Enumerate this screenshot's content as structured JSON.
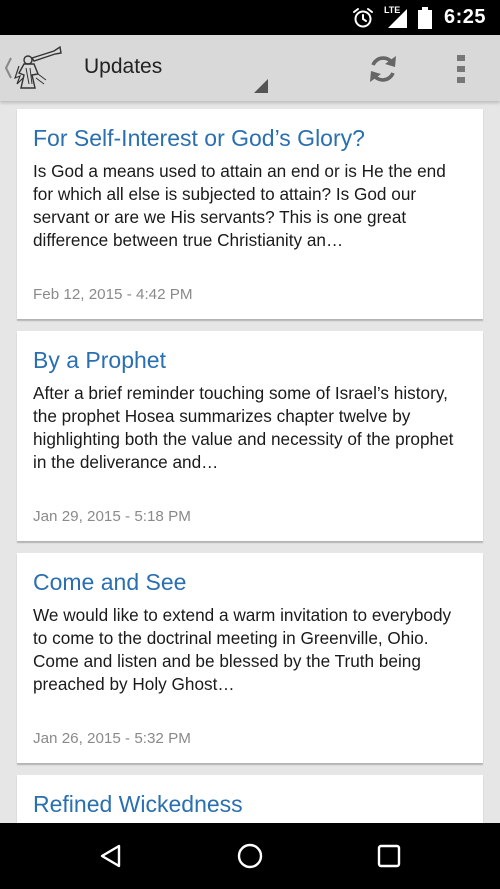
{
  "status_bar": {
    "time": "6:25",
    "network_label": "LTE",
    "icons": [
      "alarm-icon",
      "lte-signal-icon",
      "battery-icon"
    ]
  },
  "action_bar": {
    "title": "Updates",
    "icons": [
      "up-chevron-icon",
      "app-logo-icon",
      "refresh-icon",
      "overflow-menu-icon"
    ]
  },
  "posts": [
    {
      "title": "For Self-Interest or God’s Glory?",
      "excerpt": "Is God a means used to attain an end or is He the end for which all else is subjected to attain? Is God our servant or are we His servants? This is one great difference between true Christianity an…",
      "date": "Feb 12, 2015 - 4:42 PM"
    },
    {
      "title": "By a Prophet",
      "excerpt": "After a brief reminder touching some of Israel’s history, the prophet Hosea summarizes chapter twelve by highlighting both the value and necessity of the prophet in the deliverance and…",
      "date": "Jan 29, 2015 - 5:18 PM"
    },
    {
      "title": "Come and See",
      "excerpt": "We would like to extend a warm invitation to everybody to come to the doctrinal meeting in Greenville, Ohio. Come and listen and be blessed by the Truth being preached by Holy Ghost…",
      "date": "Jan 26, 2015 - 5:32 PM"
    },
    {
      "title": "Refined Wickedness"
    }
  ],
  "nav_bar": {
    "icons": [
      "back-icon",
      "home-icon",
      "recents-icon"
    ]
  },
  "colors": {
    "link_blue": "#2a6fb0",
    "action_bar": "#d9d9d9",
    "background": "#e6e6e6"
  }
}
